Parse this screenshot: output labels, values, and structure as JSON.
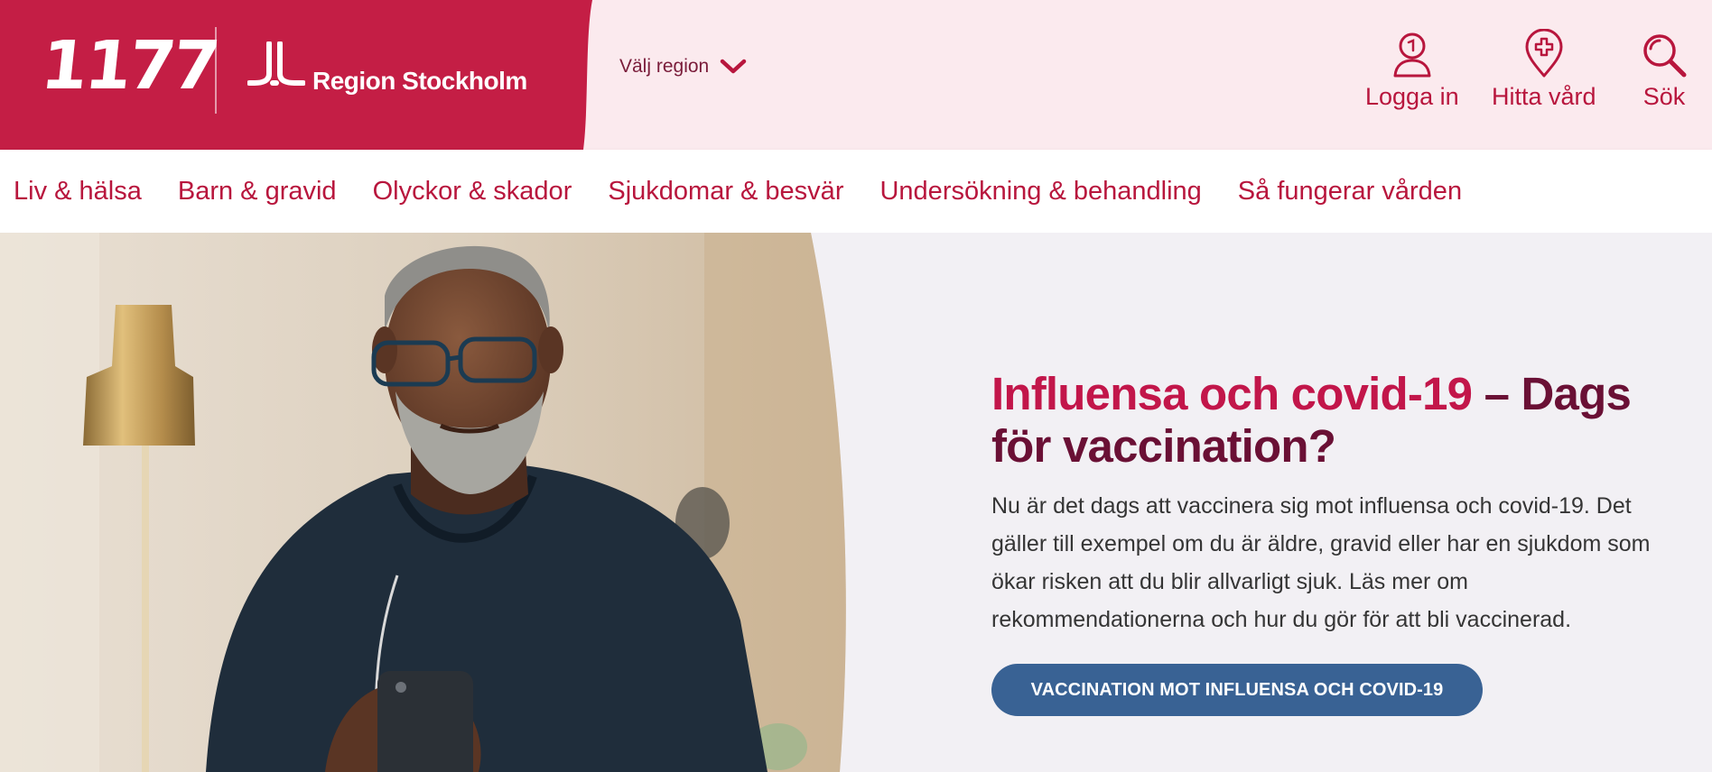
{
  "header": {
    "logo_text": "1177",
    "region_name": "Region Stockholm",
    "region_selector_label": "Välj region",
    "actions": [
      {
        "label": "Logga in",
        "icon": "user-icon"
      },
      {
        "label": "Hitta vård",
        "icon": "location-pin-icon"
      },
      {
        "label": "Sök",
        "icon": "search-icon"
      }
    ]
  },
  "nav": {
    "items": [
      {
        "label": "Liv & hälsa"
      },
      {
        "label": "Barn & gravid"
      },
      {
        "label": "Olyckor & skador"
      },
      {
        "label": "Sjukdomar & besvär"
      },
      {
        "label": "Undersökning & behandling"
      },
      {
        "label": "Så fungerar vården"
      }
    ]
  },
  "hero": {
    "title_accent": "Influensa och covid-19",
    "title_rest": " – Dags för vaccination?",
    "body": "Nu är det dags att vaccinera sig mot influensa och covid-19. Det gäller till exempel om du är äldre, gravid eller har en sjukdom som ökar risken att du blir allvarligt sjuk. Läs mer om rekommendationerna och hur du gör för att bli vaccinerad.",
    "cta_label": "VACCINATION MOT INFLUENSA OCH COVID-19"
  },
  "colors": {
    "brand_red": "#c41e45",
    "header_bg": "#fbeaee",
    "nav_text": "#b8163d",
    "title_accent": "#c2164a",
    "title_dark": "#6a1035",
    "cta_blue": "#396294",
    "hero_bg": "#f2f0f4"
  }
}
